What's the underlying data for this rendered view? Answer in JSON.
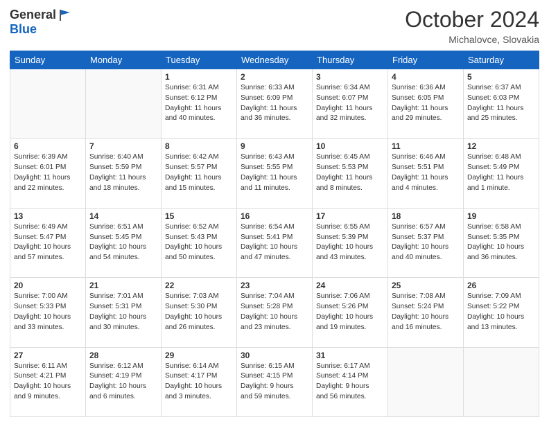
{
  "header": {
    "logo_general": "General",
    "logo_blue": "Blue",
    "month_title": "October 2024",
    "location": "Michalovce, Slovakia"
  },
  "weekdays": [
    "Sunday",
    "Monday",
    "Tuesday",
    "Wednesday",
    "Thursday",
    "Friday",
    "Saturday"
  ],
  "weeks": [
    [
      {
        "day": "",
        "info": ""
      },
      {
        "day": "",
        "info": ""
      },
      {
        "day": "1",
        "info": "Sunrise: 6:31 AM\nSunset: 6:12 PM\nDaylight: 11 hours\nand 40 minutes."
      },
      {
        "day": "2",
        "info": "Sunrise: 6:33 AM\nSunset: 6:09 PM\nDaylight: 11 hours\nand 36 minutes."
      },
      {
        "day": "3",
        "info": "Sunrise: 6:34 AM\nSunset: 6:07 PM\nDaylight: 11 hours\nand 32 minutes."
      },
      {
        "day": "4",
        "info": "Sunrise: 6:36 AM\nSunset: 6:05 PM\nDaylight: 11 hours\nand 29 minutes."
      },
      {
        "day": "5",
        "info": "Sunrise: 6:37 AM\nSunset: 6:03 PM\nDaylight: 11 hours\nand 25 minutes."
      }
    ],
    [
      {
        "day": "6",
        "info": "Sunrise: 6:39 AM\nSunset: 6:01 PM\nDaylight: 11 hours\nand 22 minutes."
      },
      {
        "day": "7",
        "info": "Sunrise: 6:40 AM\nSunset: 5:59 PM\nDaylight: 11 hours\nand 18 minutes."
      },
      {
        "day": "8",
        "info": "Sunrise: 6:42 AM\nSunset: 5:57 PM\nDaylight: 11 hours\nand 15 minutes."
      },
      {
        "day": "9",
        "info": "Sunrise: 6:43 AM\nSunset: 5:55 PM\nDaylight: 11 hours\nand 11 minutes."
      },
      {
        "day": "10",
        "info": "Sunrise: 6:45 AM\nSunset: 5:53 PM\nDaylight: 11 hours\nand 8 minutes."
      },
      {
        "day": "11",
        "info": "Sunrise: 6:46 AM\nSunset: 5:51 PM\nDaylight: 11 hours\nand 4 minutes."
      },
      {
        "day": "12",
        "info": "Sunrise: 6:48 AM\nSunset: 5:49 PM\nDaylight: 11 hours\nand 1 minute."
      }
    ],
    [
      {
        "day": "13",
        "info": "Sunrise: 6:49 AM\nSunset: 5:47 PM\nDaylight: 10 hours\nand 57 minutes."
      },
      {
        "day": "14",
        "info": "Sunrise: 6:51 AM\nSunset: 5:45 PM\nDaylight: 10 hours\nand 54 minutes."
      },
      {
        "day": "15",
        "info": "Sunrise: 6:52 AM\nSunset: 5:43 PM\nDaylight: 10 hours\nand 50 minutes."
      },
      {
        "day": "16",
        "info": "Sunrise: 6:54 AM\nSunset: 5:41 PM\nDaylight: 10 hours\nand 47 minutes."
      },
      {
        "day": "17",
        "info": "Sunrise: 6:55 AM\nSunset: 5:39 PM\nDaylight: 10 hours\nand 43 minutes."
      },
      {
        "day": "18",
        "info": "Sunrise: 6:57 AM\nSunset: 5:37 PM\nDaylight: 10 hours\nand 40 minutes."
      },
      {
        "day": "19",
        "info": "Sunrise: 6:58 AM\nSunset: 5:35 PM\nDaylight: 10 hours\nand 36 minutes."
      }
    ],
    [
      {
        "day": "20",
        "info": "Sunrise: 7:00 AM\nSunset: 5:33 PM\nDaylight: 10 hours\nand 33 minutes."
      },
      {
        "day": "21",
        "info": "Sunrise: 7:01 AM\nSunset: 5:31 PM\nDaylight: 10 hours\nand 30 minutes."
      },
      {
        "day": "22",
        "info": "Sunrise: 7:03 AM\nSunset: 5:30 PM\nDaylight: 10 hours\nand 26 minutes."
      },
      {
        "day": "23",
        "info": "Sunrise: 7:04 AM\nSunset: 5:28 PM\nDaylight: 10 hours\nand 23 minutes."
      },
      {
        "day": "24",
        "info": "Sunrise: 7:06 AM\nSunset: 5:26 PM\nDaylight: 10 hours\nand 19 minutes."
      },
      {
        "day": "25",
        "info": "Sunrise: 7:08 AM\nSunset: 5:24 PM\nDaylight: 10 hours\nand 16 minutes."
      },
      {
        "day": "26",
        "info": "Sunrise: 7:09 AM\nSunset: 5:22 PM\nDaylight: 10 hours\nand 13 minutes."
      }
    ],
    [
      {
        "day": "27",
        "info": "Sunrise: 6:11 AM\nSunset: 4:21 PM\nDaylight: 10 hours\nand 9 minutes."
      },
      {
        "day": "28",
        "info": "Sunrise: 6:12 AM\nSunset: 4:19 PM\nDaylight: 10 hours\nand 6 minutes."
      },
      {
        "day": "29",
        "info": "Sunrise: 6:14 AM\nSunset: 4:17 PM\nDaylight: 10 hours\nand 3 minutes."
      },
      {
        "day": "30",
        "info": "Sunrise: 6:15 AM\nSunset: 4:15 PM\nDaylight: 9 hours\nand 59 minutes."
      },
      {
        "day": "31",
        "info": "Sunrise: 6:17 AM\nSunset: 4:14 PM\nDaylight: 9 hours\nand 56 minutes."
      },
      {
        "day": "",
        "info": ""
      },
      {
        "day": "",
        "info": ""
      }
    ]
  ]
}
